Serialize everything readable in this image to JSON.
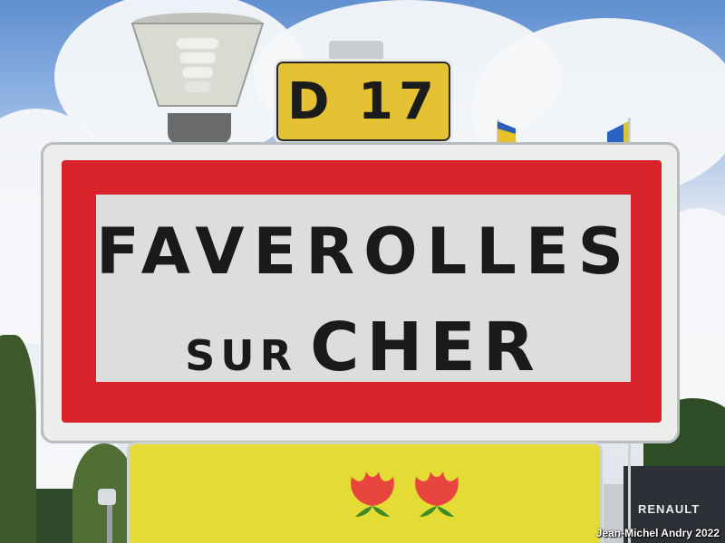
{
  "route_sign": {
    "text": "D 17",
    "background": "#e4c233"
  },
  "town_sign": {
    "line1": "FAVEROLLES",
    "line2_small": "SUR",
    "line2_large": "CHER",
    "border_color": "#d8232a",
    "background": "#dcdedd"
  },
  "lower_sign": {
    "background": "#e4dc34",
    "icons": [
      "flower-icon",
      "flower-icon"
    ]
  },
  "background_building": {
    "label": "RENAULT"
  },
  "watermark": "Jean-Michel Andry 2022"
}
